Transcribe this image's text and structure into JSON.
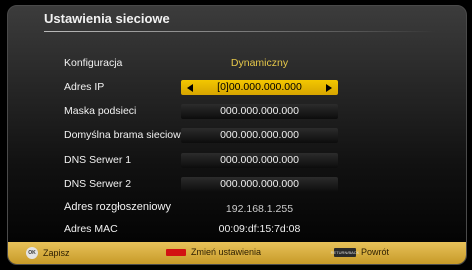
{
  "title": "Ustawienia sieciowe",
  "rows": [
    {
      "label": "Konfiguracja",
      "value": "Dynamiczny"
    },
    {
      "label": "Adres IP",
      "value": "[0]00.000.000.000"
    },
    {
      "label": "Maska podsieci",
      "value": "000.000.000.000"
    },
    {
      "label": "Domyślna brama sieciowa",
      "value": "000.000.000.000"
    },
    {
      "label": "DNS Serwer 1",
      "value": "000.000.000.000"
    },
    {
      "label": "DNS Serwer 2",
      "value": "000.000.000.000"
    },
    {
      "label": "Adres rozgłoszeniowy",
      "value": "192.168.1.255"
    },
    {
      "label": "Adres MAC",
      "value": "00:09:df:15:7d:08"
    }
  ],
  "footer": {
    "ok_key": "OK",
    "save": "Zapisz",
    "change": "Zmień ustawienia",
    "return_key": "RETURN/BACK",
    "back": "Powrót"
  },
  "colors": {
    "accent_yellow": "#f3c700",
    "config_value": "#e6c84a",
    "broadcast_value": "#cccccc",
    "footer_bar": "#d8ad3c",
    "red_key": "#d21212"
  }
}
